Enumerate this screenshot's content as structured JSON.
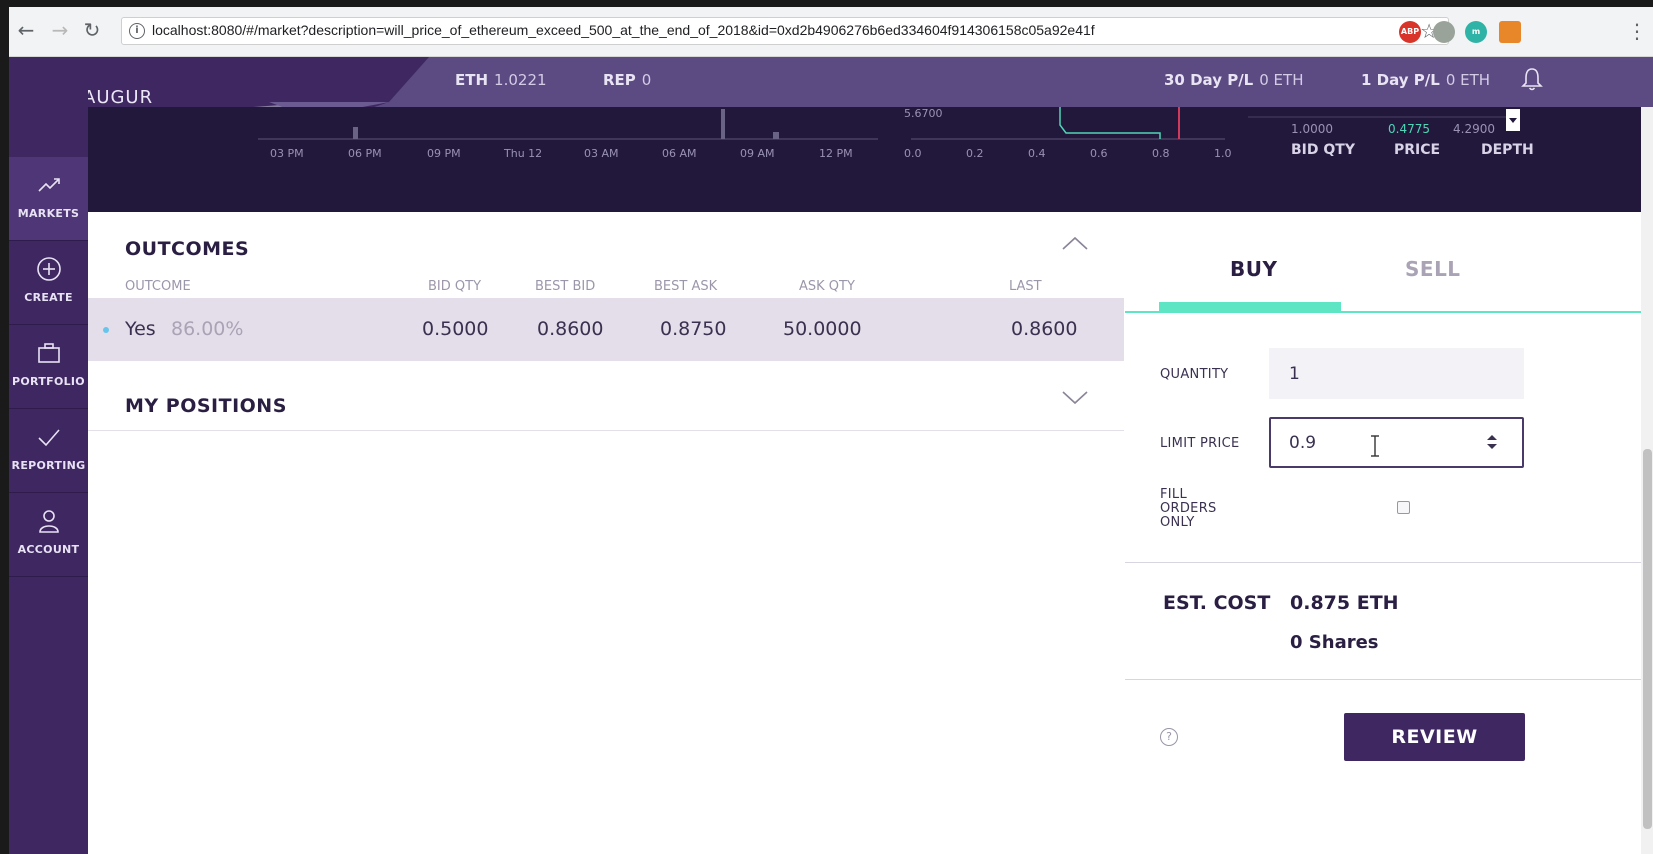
{
  "browser": {
    "url": "localhost:8080/#/market?description=will_price_of_ethereum_exceed_500_at_the_end_of_2018&id=0xd2b4906276b6ed334604f914306158c05a92e41f",
    "extensions": [
      "ABP",
      "evernote",
      "m",
      "fox"
    ]
  },
  "brand": {
    "name": "AUGUR"
  },
  "header": {
    "eth_label": "ETH",
    "eth_value": "1.0221",
    "rep_label": "REP",
    "rep_value": "0",
    "pl30_label": "30 Day P/L",
    "pl30_value": "0 ETH",
    "pl1_label": "1 Day P/L",
    "pl1_value": "0 ETH"
  },
  "sidebar": {
    "items": [
      {
        "label": "MARKETS",
        "icon": "trend-icon"
      },
      {
        "label": "CREATE",
        "icon": "plus-circle-icon"
      },
      {
        "label": "PORTFOLIO",
        "icon": "briefcase-icon"
      },
      {
        "label": "REPORTING",
        "icon": "check-icon"
      },
      {
        "label": "ACCOUNT",
        "icon": "person-icon"
      }
    ]
  },
  "chart_strip": {
    "time_ticks": [
      "03 PM",
      "06 PM",
      "09 PM",
      "Thu 12",
      "03 AM",
      "06 AM",
      "09 AM",
      "12 PM"
    ],
    "depth_ticks": [
      "0.0",
      "0.2",
      "0.4",
      "0.6",
      "0.8",
      "1.0"
    ],
    "depth_label": "5.6700",
    "orderbook_row": {
      "qty": "1.0000",
      "price": "0.4775",
      "depth": "4.2900"
    },
    "orderbook_headers": {
      "qty": "BID QTY",
      "price": "PRICE",
      "depth": "DEPTH"
    }
  },
  "outcomes": {
    "title": "OUTCOMES",
    "columns": {
      "outcome": "OUTCOME",
      "bid_qty": "BID QTY",
      "best_bid": "BEST BID",
      "best_ask": "BEST ASK",
      "ask_qty": "ASK QTY",
      "last": "LAST"
    },
    "rows": [
      {
        "name": "Yes",
        "percent": "86.00%",
        "bid_qty": "0.5000",
        "best_bid": "0.8600",
        "best_ask": "0.8750",
        "ask_qty": "50.0000",
        "last": "0.8600"
      }
    ]
  },
  "positions": {
    "title": "MY POSITIONS"
  },
  "trade": {
    "buy_label": "BUY",
    "sell_label": "SELL",
    "quantity_label": "QUANTITY",
    "quantity_value": "1",
    "limit_label": "LIMIT PRICE",
    "limit_value": "0.9",
    "fill_label_1": "FILL",
    "fill_label_2": "ORDERS",
    "fill_label_3": "ONLY",
    "est_label": "EST. COST",
    "est_eth": "0.875 ETH",
    "est_shares": "0 Shares",
    "help_glyph": "?",
    "review_label": "REVIEW"
  },
  "colors": {
    "brand_purple": "#3f2862",
    "accent_teal": "#5ee5c4",
    "header": "#5c4a83",
    "chart_bg": "#22183b"
  }
}
